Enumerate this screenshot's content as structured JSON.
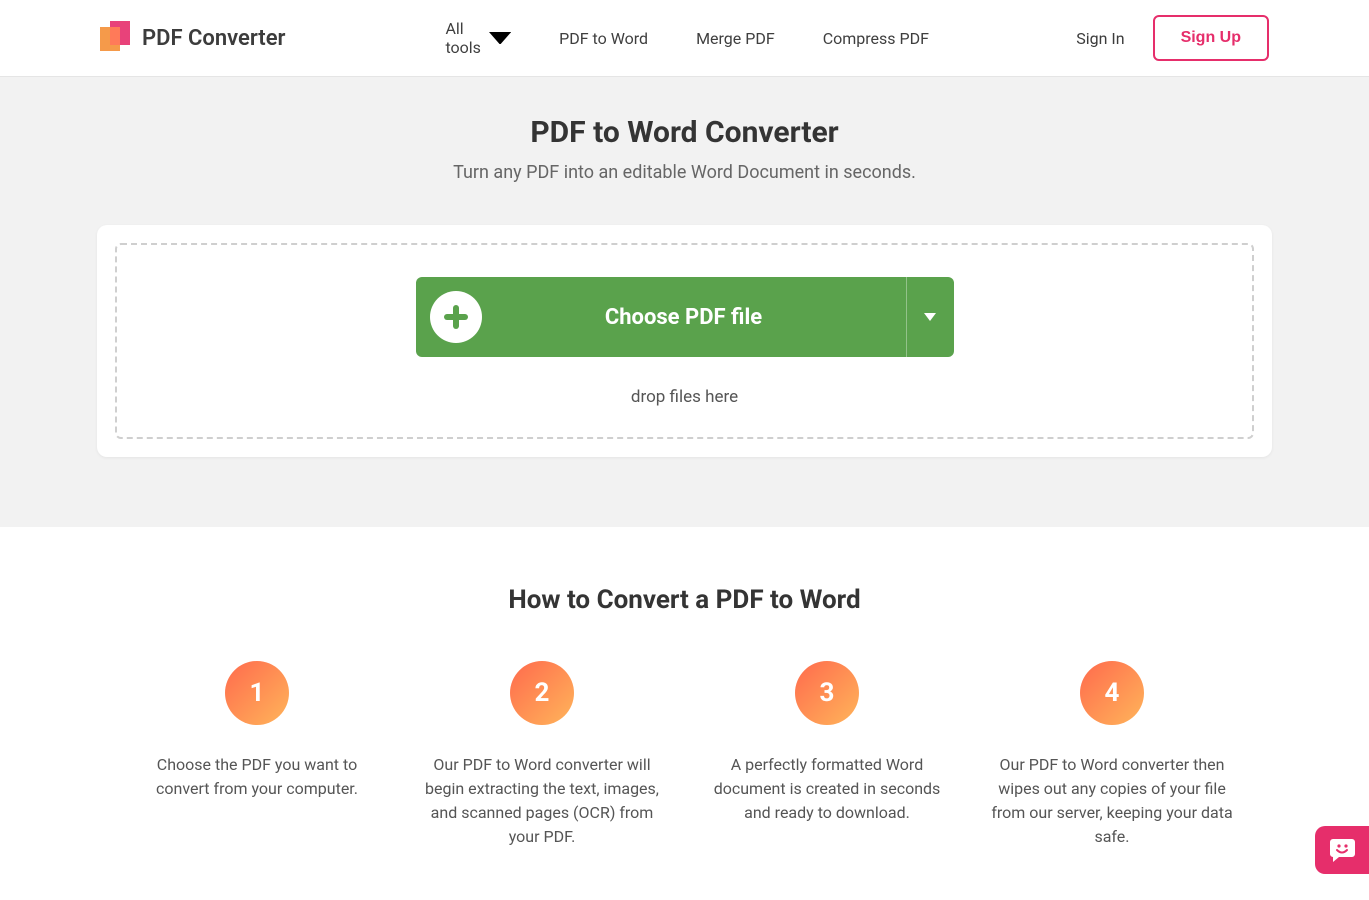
{
  "brand": {
    "name": "PDF Converter"
  },
  "nav": {
    "all_tools_label": "All tools",
    "items": [
      "PDF to Word",
      "Merge PDF",
      "Compress PDF"
    ]
  },
  "auth": {
    "signin": "Sign In",
    "signup": "Sign Up"
  },
  "hero": {
    "title": "PDF to Word Converter",
    "subtitle": "Turn any PDF into an editable Word Document in seconds."
  },
  "upload": {
    "button_label": "Choose PDF file",
    "drop_hint": "drop files here"
  },
  "howto": {
    "title": "How to Convert a PDF to Word",
    "steps": [
      {
        "num": "1",
        "desc": "Choose the PDF you want to convert from your computer."
      },
      {
        "num": "2",
        "desc": "Our PDF to Word converter will begin extracting the text, images, and scanned pages (OCR) from your PDF."
      },
      {
        "num": "3",
        "desc": "A perfectly formatted Word document is created in seconds and ready to download."
      },
      {
        "num": "4",
        "desc": "Our PDF to Word converter then wipes out any copies of your file from our server, keeping your data safe."
      }
    ]
  },
  "colors": {
    "accent": "#e62e6b",
    "upload": "#5aa24c"
  }
}
